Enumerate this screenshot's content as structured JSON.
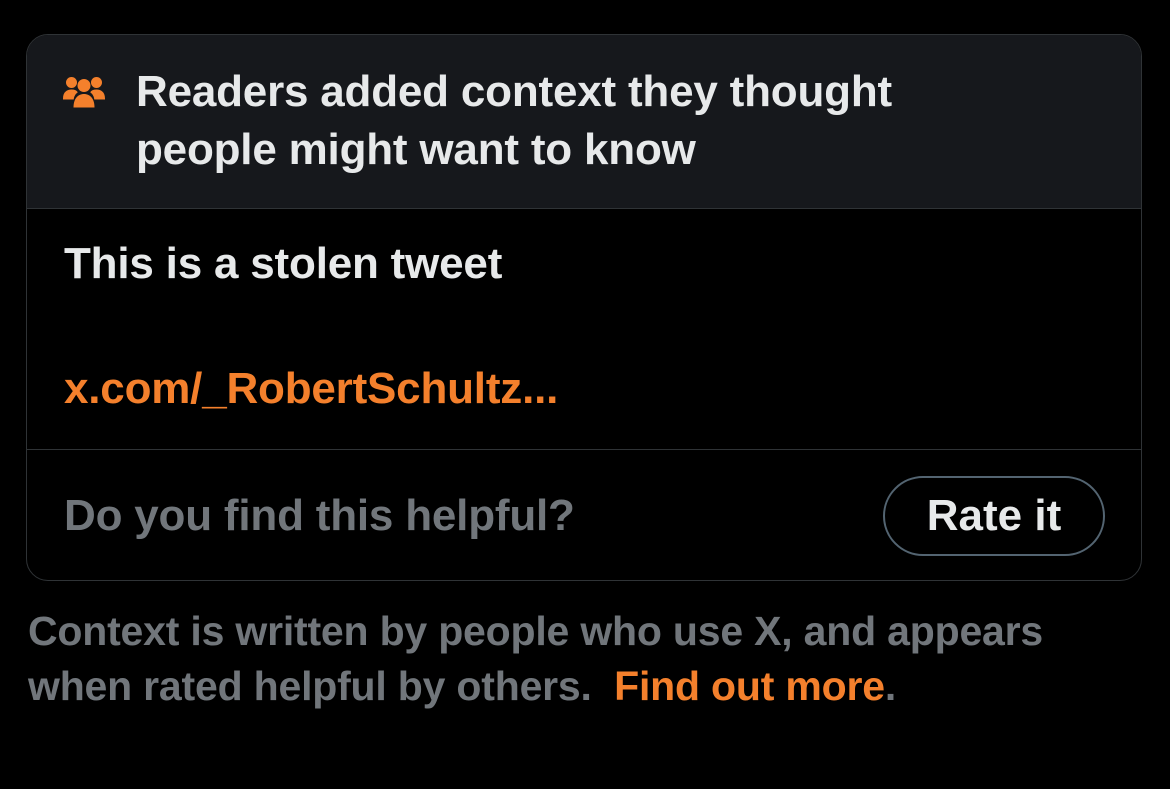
{
  "note": {
    "header": {
      "icon": "people-group-icon",
      "text": "Readers added context they thought people might want to know"
    },
    "body": {
      "text": "This is a stolen tweet",
      "link": "x.com/_RobertSchultz..."
    },
    "rating": {
      "question": "Do you find this helpful?",
      "button_label": "Rate it"
    }
  },
  "footer": {
    "text": "Context is written by people who use X, and appears when rated helpful by others.",
    "link": "Find out more",
    "trailing": "."
  },
  "colors": {
    "background": "#000000",
    "header_background": "#16181c",
    "accent": "#f4802c",
    "primary_text": "#e7e9ea",
    "secondary_text": "#71767b",
    "border": "#2f3336"
  }
}
